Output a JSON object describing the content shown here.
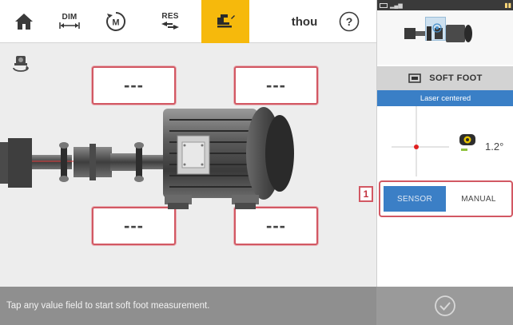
{
  "toolbar": {
    "dim_label": "DIM",
    "m_label": "M",
    "res_label": "RES",
    "units_label": "thou",
    "help_label": "?"
  },
  "fields": {
    "front_left": "---",
    "front_right": "---",
    "rear_left": "---",
    "rear_right": "---"
  },
  "status": {
    "message": "Tap any value field to start soft foot measurement."
  },
  "side": {
    "title": "SOFT FOOT",
    "laser_status": "Laser centered",
    "angle": "1.2°",
    "mode_marker": "1",
    "mode_sensor": "SENSOR",
    "mode_manual": "MANUAL"
  },
  "colors": {
    "accent_yellow": "#f6b90c",
    "active_blue": "#3a7fc6",
    "highlight_red": "#d25863",
    "status_bar_gray": "#8f8f8f"
  },
  "icons": [
    "home-icon",
    "dim-icon",
    "m-icon",
    "res-icon",
    "soft-foot-icon",
    "help-icon",
    "rotate-view-icon",
    "checkmark-icon"
  ]
}
